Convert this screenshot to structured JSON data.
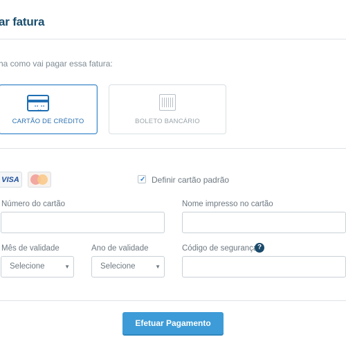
{
  "header": {
    "title": "ar fatura"
  },
  "payment": {
    "prompt": "ha como vai pagar essa fatura:",
    "options": [
      {
        "label": "CARTÃO DE CRÉDITO",
        "icon": "credit-card-icon",
        "selected": true
      },
      {
        "label": "BOLETO BANCÁRIO",
        "icon": "barcode-icon",
        "selected": false
      }
    ]
  },
  "card": {
    "brands": [
      {
        "name": "VISA",
        "icon": "visa-logo"
      },
      {
        "name": "MasterCard",
        "icon": "mastercard-logo"
      }
    ],
    "default_checkbox": {
      "label": "Definir cartão padrão",
      "checked": true
    },
    "fields": {
      "number_label": "Número do cartão",
      "number_value": "",
      "name_label": "Nome impresso no cartão",
      "name_value": "",
      "month_label": "Mês de validade",
      "month_value": "Selecione",
      "year_label": "Ano de validade",
      "year_value": "Selecione",
      "cvv_label": "Código de segurança",
      "cvv_value": ""
    }
  },
  "actions": {
    "submit_label": "Efetuar Pagamento"
  },
  "colors": {
    "accent": "#3d9bd7",
    "title": "#1a4e6e",
    "selected_border": "#3a86c8"
  }
}
